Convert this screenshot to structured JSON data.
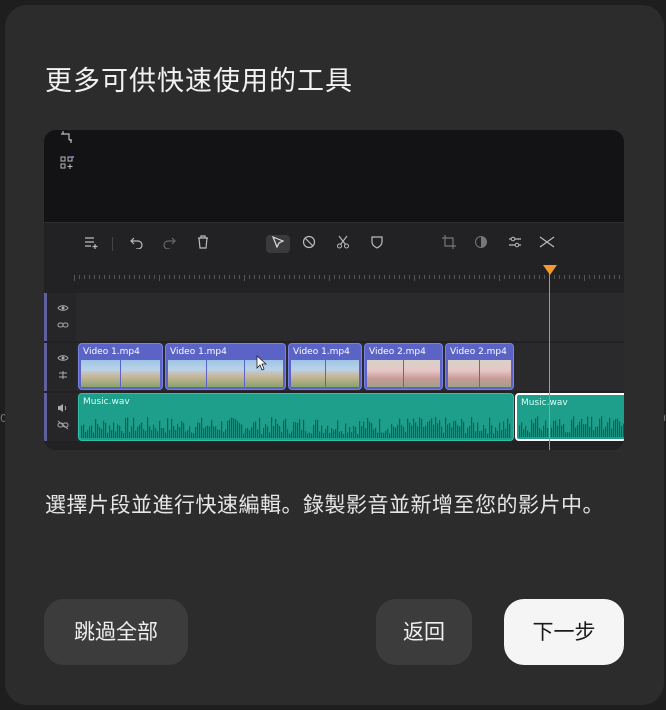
{
  "dialog": {
    "title": "更多可供快速使用的工具",
    "description": "選擇片段並進行快速編輯。錄製影音並新增至您的影片中。",
    "buttons": {
      "skip_all": "跳過全部",
      "back": "返回",
      "next": "下一步"
    }
  },
  "preview": {
    "toolbar_icons": [
      "add-track-icon",
      "undo-icon",
      "redo-icon",
      "delete-icon",
      "select-pointer-icon",
      "blade-icon",
      "scissors-icon",
      "shield-icon",
      "crop-icon",
      "color-icon",
      "adjust-icon",
      "transition-icon"
    ],
    "video_clips": [
      {
        "label": "Video 1.mp4"
      },
      {
        "label": "Video 1.mp4"
      },
      {
        "label": "Video 1.mp4"
      },
      {
        "label": "Video 2.mp4"
      },
      {
        "label": "Video 2.mp4"
      }
    ],
    "audio_clips": [
      {
        "label": "Music.wav"
      },
      {
        "label": "Music.wav"
      }
    ],
    "colors": {
      "video_clip": "#5b63c7",
      "audio_clip": "#1d9f8c",
      "playhead": "#f29a2e"
    }
  },
  "edge": {
    "left": "0",
    "right": "0"
  }
}
